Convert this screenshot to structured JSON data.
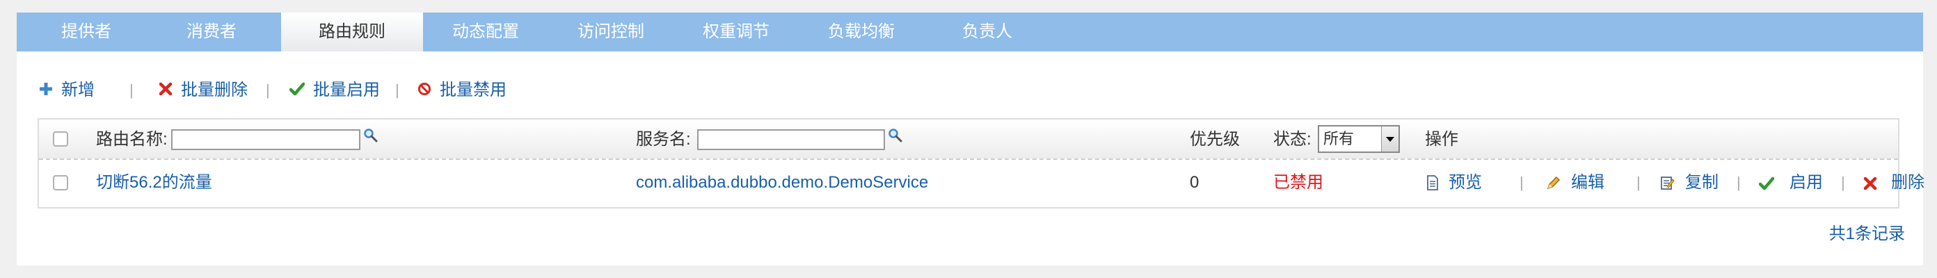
{
  "tabs": [
    {
      "label": "提供者"
    },
    {
      "label": "消费者"
    },
    {
      "label": "路由规则",
      "active": true
    },
    {
      "label": "动态配置"
    },
    {
      "label": "访问控制"
    },
    {
      "label": "权重调节"
    },
    {
      "label": "负载均衡"
    },
    {
      "label": "负责人"
    }
  ],
  "toolbar": {
    "add": {
      "label": "新增",
      "icon": "plus-icon"
    },
    "batch_delete": {
      "label": "批量删除",
      "icon": "cross-icon"
    },
    "batch_enable": {
      "label": "批量启用",
      "icon": "check-icon"
    },
    "batch_disable": {
      "label": "批量禁用",
      "icon": "ban-icon"
    },
    "separator": "|"
  },
  "table": {
    "headers": {
      "route_name": "路由名称:",
      "service_name": "服务名:",
      "priority": "优先级",
      "status": "状态:",
      "actions": "操作"
    },
    "filters": {
      "route_name_value": "",
      "service_name_value": "",
      "status_selected": "所有"
    },
    "rows": [
      {
        "name": "切断56.2的流量",
        "service": "com.alibaba.dubbo.demo.DemoService",
        "priority": "0",
        "status": "已禁用",
        "actions": {
          "preview": "预览",
          "edit": "编辑",
          "copy": "复制",
          "enable": "启用",
          "delete": "删除"
        }
      }
    ]
  },
  "footer": {
    "record_count": "共1条记录"
  },
  "colors": {
    "tab_bar": "#8fbce9",
    "link": "#1a5fa8",
    "status_disabled": "#e0161b",
    "check_green": "#2e9a2e",
    "cross_red": "#d9261c"
  }
}
